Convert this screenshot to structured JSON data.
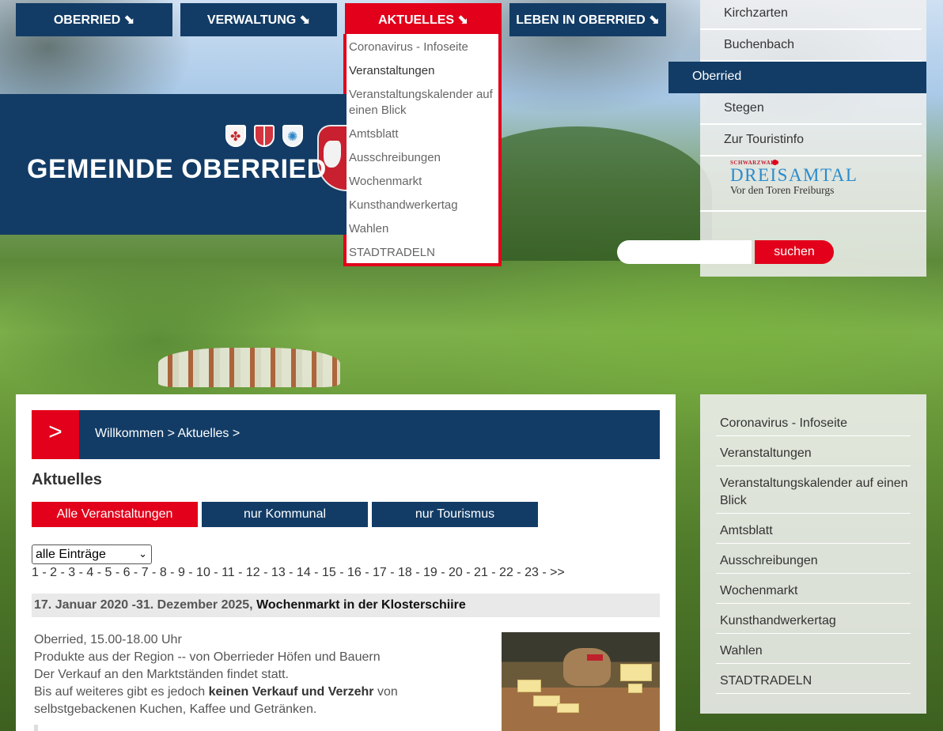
{
  "nav": {
    "items": [
      {
        "label": "OBERRIED ⬊"
      },
      {
        "label": "VERWALTUNG ⬊"
      },
      {
        "label": "AKTUELLES ⬊"
      },
      {
        "label": "LEBEN IN OBERRIED ⬊"
      }
    ],
    "active_color": "#e2001a",
    "base_color": "#123c66"
  },
  "dropdown": {
    "items": [
      {
        "label": "Coronavirus - Infoseite"
      },
      {
        "label": "Veranstaltungen"
      },
      {
        "label": "Veranstaltungskalender auf einen Blick"
      },
      {
        "label": "Amtsblatt"
      },
      {
        "label": "Ausschreibungen"
      },
      {
        "label": "Wochenmarkt"
      },
      {
        "label": "Kunsthandwerkertag"
      },
      {
        "label": "Wahlen"
      },
      {
        "label": "STADTRADELN"
      }
    ]
  },
  "header": {
    "title": "GEMEINDE OBERRIED"
  },
  "town_menu": {
    "items": [
      {
        "label": "Kirchzarten"
      },
      {
        "label": "Buchenbach"
      },
      {
        "label": "Oberried"
      },
      {
        "label": "Stegen"
      },
      {
        "label": "Zur Touristinfo"
      }
    ],
    "selected": "Oberried"
  },
  "logo": {
    "top": "SCHWARZWALD",
    "main": "DREISAMTAL",
    "sub": "Vor den Toren Freiburgs"
  },
  "search": {
    "value": "",
    "button_label": "suchen"
  },
  "breadcrumb": {
    "arrow": ">",
    "text": "Willkommen > Aktuelles >"
  },
  "main": {
    "heading": "Aktuelles",
    "filters": [
      {
        "label": "Alle Veranstaltungen"
      },
      {
        "label": "nur Kommunal"
      },
      {
        "label": "nur Tourismus"
      }
    ],
    "select_value": "alle Einträge",
    "pager": "1 - 2 - 3 - 4 - 5 - 6 - 7 - 8 - 9 - 10 - 11 - 12 - 13 - 14 - 15 - 16 - 17 - 18 - 19 - 20 - 21 - 22 - 23 - >>",
    "entry": {
      "date": "17. Januar 2020 -31. Dezember 2025,",
      "title": "Wochenmarkt in der Klosterschiire",
      "line1": "Oberried, 15.00-18.00 Uhr",
      "line2": "Produkte aus der Region -- von Oberrieder Höfen und Bauern",
      "line3": "Der Verkauf an den Marktständen findet statt.",
      "line4_pre": "Bis auf weiteres gibt es jedoch ",
      "line4_bold": "keinen Verkauf und Verzehr",
      "line4_post": " von",
      "line5": "selbstgebackenen Kuchen, Kaffee und Getränken."
    }
  },
  "side_menu": {
    "items": [
      {
        "label": "Coronavirus - Infoseite"
      },
      {
        "label": "Veranstaltungen"
      },
      {
        "label": "Veranstaltungskalender auf einen Blick"
      },
      {
        "label": "Amtsblatt"
      },
      {
        "label": "Ausschreibungen"
      },
      {
        "label": "Wochenmarkt"
      },
      {
        "label": "Kunsthandwerkertag"
      },
      {
        "label": "Wahlen"
      },
      {
        "label": "STADTRADELN"
      }
    ]
  }
}
